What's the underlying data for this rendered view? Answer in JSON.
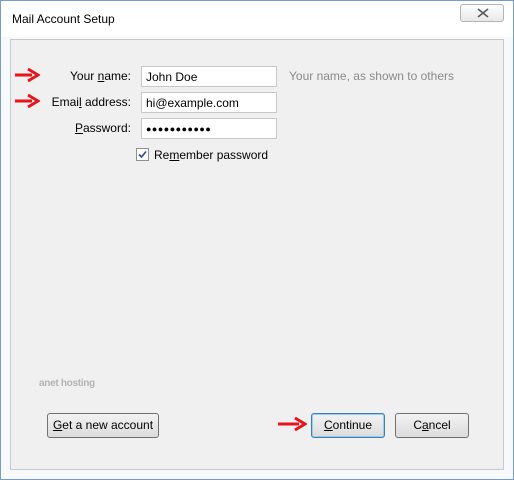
{
  "window": {
    "title": "Mail Account Setup"
  },
  "form": {
    "name_label_pre": "Your ",
    "name_label_ul": "n",
    "name_label_post": "ame:",
    "name_value": "John Doe",
    "name_hint": "Your name, as shown to others",
    "email_label_pre": "Emai",
    "email_label_ul": "l",
    "email_label_post": " address:",
    "email_value": "hi@example.com",
    "password_label_ul": "P",
    "password_label_post": "assword:",
    "password_value": "●●●●●●●●●●●",
    "remember_ul_pre": "Re",
    "remember_ul": "m",
    "remember_post": "ember password",
    "remember_checked": true
  },
  "watermark": "anet hosting",
  "buttons": {
    "new_account_ul": "G",
    "new_account_rest": "et a new account",
    "continue_ul": "C",
    "continue_rest": "ontinue",
    "cancel_pre": "C",
    "cancel_ul": "a",
    "cancel_rest": "ncel"
  },
  "colors": {
    "annotation_arrow": "#e8141b",
    "hint_text": "#8a8a8a"
  },
  "icons": [
    "close-icon",
    "checkmark-icon",
    "arrow-right-icon"
  ]
}
